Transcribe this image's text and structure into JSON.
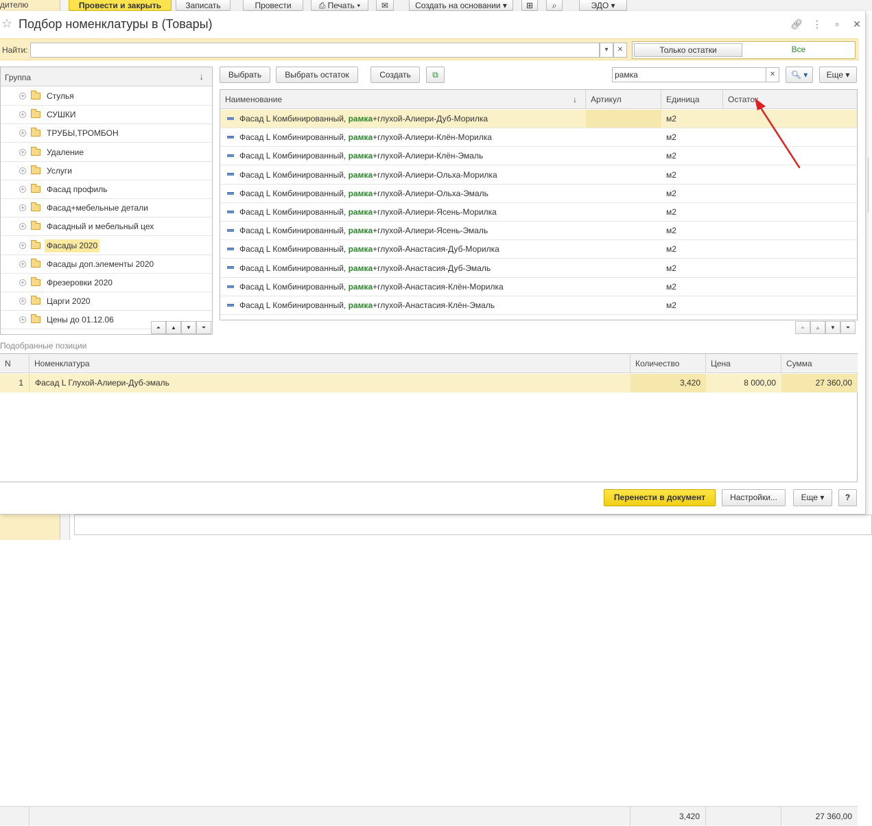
{
  "background": {
    "left_label": "дителю",
    "toolbar": {
      "post_close": "Провести и закрыть",
      "save": "Записать",
      "post": "Провести",
      "print": "Печать",
      "create_based": "Создать на основании",
      "edo": "ЭДО"
    }
  },
  "dialog": {
    "title": "Подбор номенклатуры в  (Товары)",
    "find_label": "Найти:",
    "find_value": "",
    "toggle": {
      "only_stock": "Только остатки",
      "all": "Все"
    }
  },
  "groups": {
    "header": "Группа",
    "items": [
      {
        "label": "Стулья",
        "selected": false
      },
      {
        "label": "СУШКИ",
        "selected": false
      },
      {
        "label": "ТРУБЫ,ТРОМБОН",
        "selected": false
      },
      {
        "label": "Удаление",
        "selected": false
      },
      {
        "label": "Услуги",
        "selected": false
      },
      {
        "label": "Фасад профиль",
        "selected": false
      },
      {
        "label": "Фасад+мебельные детали",
        "selected": false
      },
      {
        "label": "Фасадный и мебельный цех",
        "selected": false
      },
      {
        "label": "Фасады 2020",
        "selected": true
      },
      {
        "label": "Фасады доп.элементы 2020",
        "selected": false
      },
      {
        "label": "Фрезеровки 2020",
        "selected": false
      },
      {
        "label": "Царги 2020",
        "selected": false
      },
      {
        "label": "Цены до 01.12.06",
        "selected": false
      }
    ]
  },
  "toolbar": {
    "select": "Выбрать",
    "select_rest": "Выбрать остаток",
    "create": "Создать",
    "search_value": "рамка",
    "more": "Еще"
  },
  "items_table": {
    "columns": [
      "Наименование",
      "Артикул",
      "Единица",
      "Остаток"
    ],
    "highlight": "рамка",
    "rows": [
      {
        "pre": "Фасад L Комбинированный, ",
        "hl": "рамка",
        "post": "+глухой-Алиери-Дуб-Морилка",
        "unit": "м2"
      },
      {
        "pre": "Фасад L Комбинированный, ",
        "hl": "рамка",
        "post": "+глухой-Алиери-Клён-Морилка",
        "unit": "м2"
      },
      {
        "pre": "Фасад L Комбинированный, ",
        "hl": "рамка",
        "post": "+глухой-Алиери-Клён-Эмаль",
        "unit": "м2"
      },
      {
        "pre": "Фасад L Комбинированный, ",
        "hl": "рамка",
        "post": "+глухой-Алиери-Ольха-Морилка",
        "unit": "м2"
      },
      {
        "pre": "Фасад L Комбинированный, ",
        "hl": "рамка",
        "post": "+глухой-Алиери-Ольха-Эмаль",
        "unit": "м2"
      },
      {
        "pre": "Фасад L Комбинированный, ",
        "hl": "рамка",
        "post": "+глухой-Алиери-Ясень-Морилка",
        "unit": "м2"
      },
      {
        "pre": "Фасад L Комбинированный, ",
        "hl": "рамка",
        "post": "+глухой-Алиери-Ясень-Эмаль",
        "unit": "м2"
      },
      {
        "pre": "Фасад L Комбинированный, ",
        "hl": "рамка",
        "post": "+глухой-Анастасия-Дуб-Морилка",
        "unit": "м2"
      },
      {
        "pre": "Фасад L Комбинированный, ",
        "hl": "рамка",
        "post": "+глухой-Анастасия-Дуб-Эмаль",
        "unit": "м2"
      },
      {
        "pre": "Фасад L Комбинированный, ",
        "hl": "рамка",
        "post": "+глухой-Анастасия-Клён-Морилка",
        "unit": "м2"
      },
      {
        "pre": "Фасад L Комбинированный, ",
        "hl": "рамка",
        "post": "+глухой-Анастасия-Клён-Эмаль",
        "unit": "м2"
      }
    ]
  },
  "picked": {
    "label": "Подобранные позиции",
    "columns": [
      "N",
      "Номенклатура",
      "Количество",
      "Цена",
      "Сумма"
    ],
    "rows": [
      {
        "n": "1",
        "name": "Фасад L Глухой-Алиери-Дуб-эмаль",
        "qty": "3,420",
        "price": "8 000,00",
        "sum": "27 360,00"
      }
    ],
    "totals": {
      "qty": "3,420",
      "sum": "27 360,00"
    }
  },
  "bottom_buttons": {
    "transfer": "Перенести в документ",
    "settings": "Настройки...",
    "more": "Еще",
    "help": "?"
  },
  "colors": {
    "accent_yellow": "#fbe34d",
    "selection": "#fbf1c8",
    "highlight_green": "#2b8a2b",
    "annotation_red": "#e02020"
  }
}
